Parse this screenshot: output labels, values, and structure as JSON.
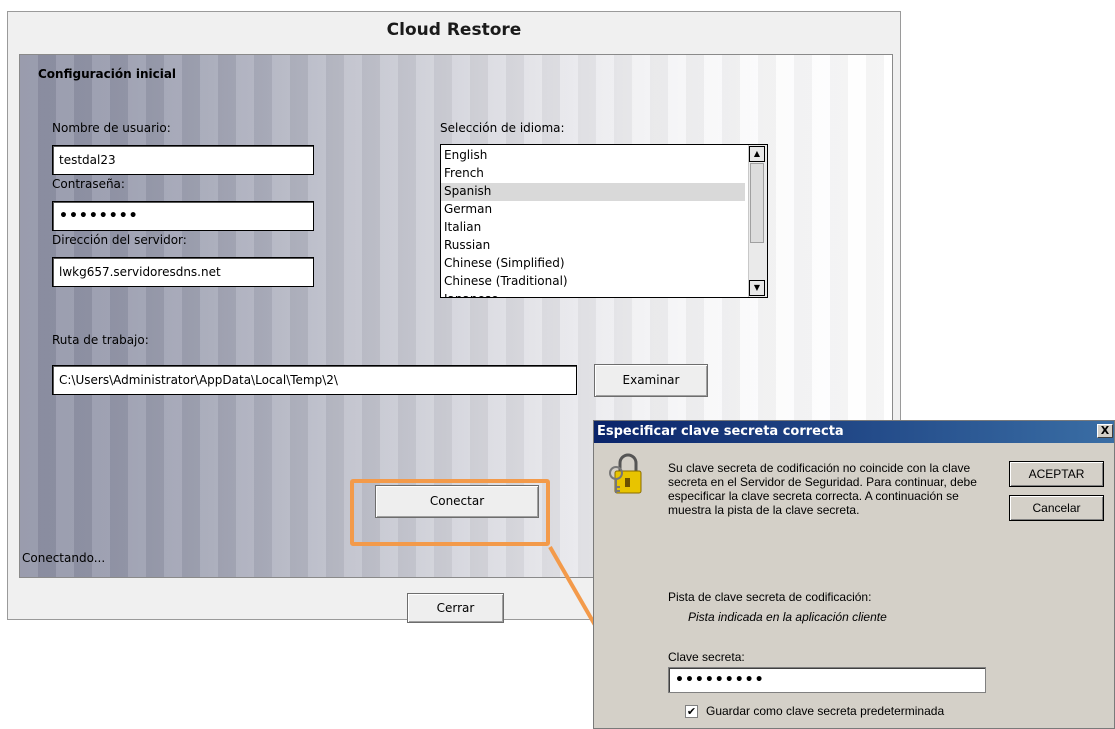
{
  "main_window": {
    "title": "Cloud Restore",
    "section_title": "Configuración inicial",
    "username_label": "Nombre de usuario:",
    "username_value": "testdal23",
    "password_label": "Contraseña:",
    "password_value": "••••••••",
    "server_label": "Dirección del servidor:",
    "server_value": "lwkg657.servidoresdns.net",
    "language_label": "Selección de idioma:",
    "languages": [
      "English",
      "French",
      "Spanish",
      "German",
      "Italian",
      "Russian",
      "Chinese (Simplified)",
      "Chinese (Traditional)",
      "Japanese"
    ],
    "selected_language": "Spanish",
    "workpath_label": "Ruta de trabajo:",
    "workpath_value": "C:\\Users\\Administrator\\AppData\\Local\\Temp\\2\\",
    "browse_button": "Examinar",
    "connect_button": "Conectar",
    "status": "Conectando...",
    "close_button": "Cerrar"
  },
  "dialog": {
    "title": "Especificar clave secreta correcta",
    "message": "Su clave secreta de codificación no coincide con la clave secreta en el Servidor de Seguridad.  Para continuar, debe especificar la clave secreta correcta. A continuación se muestra la pista de la clave secreta.",
    "hint_label": "Pista de clave secreta de codificación:",
    "hint_value": "Pista indicada en la aplicación cliente",
    "secret_label": "Clave secreta:",
    "secret_value": "•••••••••",
    "remember_label": "Guardar como clave secreta predeterminada",
    "remember_checked": true,
    "ok_button": "ACEPTAR",
    "cancel_button": "Cancelar",
    "close_glyph": "X"
  },
  "icons": {
    "lock_keys": "lock-keys-icon",
    "arrow_annotation": "arrow-icon"
  },
  "colors": {
    "highlight": "#f39a4a",
    "dialog_title": "#0a246a"
  }
}
